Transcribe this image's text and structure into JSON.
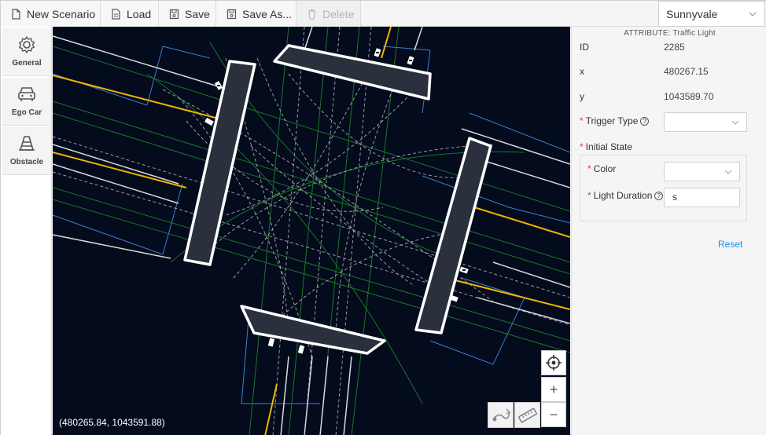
{
  "toolbar": {
    "new_label": "New Scenario",
    "load_label": "Load",
    "save_label": "Save",
    "save_as_label": "Save As...",
    "delete_label": "Delete",
    "city": "Sunnyvale"
  },
  "nav": {
    "general": "General",
    "ego_car": "Ego Car",
    "obstacle": "Obstacle"
  },
  "map": {
    "coordinates": "(480265.84, 1043591.88)",
    "zoom_in": "+",
    "zoom_out": "−"
  },
  "panel": {
    "title": "ATTRIBUTE: Traffic Light",
    "id_label": "ID",
    "id_value": "2285",
    "x_label": "x",
    "x_value": "480267.15",
    "y_label": "y",
    "y_value": "1043589.70",
    "trigger_type_label": "Trigger Type",
    "initial_state_label": "Initial State",
    "color_label": "Color",
    "light_duration_label": "Light Duration",
    "light_duration_unit": "s",
    "reset_label": "Reset"
  },
  "colors": {
    "map_background": "#030b1c",
    "lane_yellow": "#f2b400",
    "lane_green": "#1f8a2a",
    "boundary_blue": "#3d7fd6",
    "required_red": "#e5353a",
    "link_blue": "#1a8ee0"
  }
}
